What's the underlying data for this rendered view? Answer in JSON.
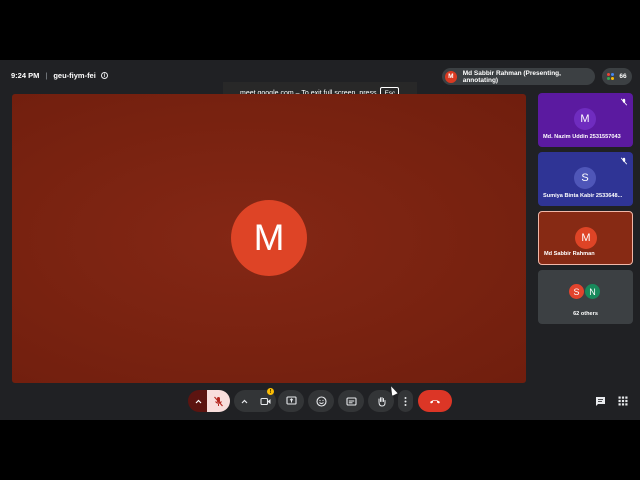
{
  "topbar": {
    "time": "9:24 PM",
    "separator": "|",
    "meeting_code": "geu-fiym-fei",
    "info_glyph": "i",
    "presenter_initial": "M",
    "presenter_label": "Md Sabbir Rahman (Presenting, annotating)",
    "participant_count": "66"
  },
  "fullscreen_notice": {
    "text": "meet.google.com – To exit full screen, press",
    "key": "Esc"
  },
  "stage": {
    "avatar_initial": "M"
  },
  "tiles": [
    {
      "initial": "M",
      "name": "Md. Nazim Uddin 2531557043",
      "muted": true
    },
    {
      "initial": "S",
      "name": "Sumiya Binta Kabir 2533648...",
      "muted": true
    },
    {
      "initial": "M",
      "name": "Md Sabbir Rahman",
      "muted": false
    },
    {
      "initials": [
        "S",
        "N"
      ],
      "name": "62 others"
    }
  ],
  "controls": {
    "camera_warning": "!"
  },
  "colors": {
    "background": "#202124",
    "stage": "#7a2210",
    "leave_button": "#dc3626",
    "mic_muted_bg": "#f9dedc",
    "tile1": "#5b1aa0",
    "tile2": "#2f3495",
    "tile3": "#872a14",
    "others_avatar_s": "#e3442d",
    "others_avatar_n": "#198a5c"
  },
  "icons": {
    "info": "info-icon",
    "people": "people-icon",
    "mic": "mic-off-icon",
    "camera": "camera-icon",
    "present": "present-screen-icon",
    "emoji": "emoji-icon",
    "captions": "captions-icon",
    "hand": "raise-hand-icon",
    "more": "more-vert-icon",
    "leave": "call-end-icon",
    "chat": "chat-icon",
    "apps": "apps-grid-icon"
  }
}
